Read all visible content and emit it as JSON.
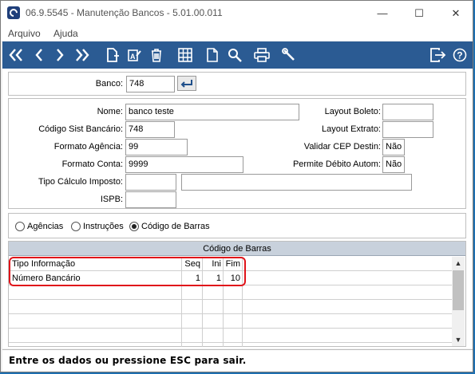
{
  "window": {
    "title": "06.9.5545 - Manutenção Bancos - 5.01.00.011"
  },
  "menu": {
    "items": [
      "Arquivo",
      "Ajuda"
    ]
  },
  "toolbar": {
    "icons": [
      "first-icon",
      "prev-icon",
      "next-icon",
      "last-icon",
      "new-icon",
      "edit-icon",
      "delete-icon",
      "grid-icon",
      "document-icon",
      "search-icon",
      "print-icon",
      "tools-icon",
      "exit-icon",
      "help-icon"
    ]
  },
  "banco": {
    "label": "Banco:",
    "value": "748"
  },
  "form": {
    "nome": {
      "label": "Nome:",
      "value": "banco teste"
    },
    "codigo": {
      "label": "Código Sist Bancário:",
      "value": "748"
    },
    "agencia": {
      "label": "Formato Agência:",
      "value": "99"
    },
    "conta": {
      "label": "Formato Conta:",
      "value": "9999"
    },
    "tipo_calculo": {
      "label": "Tipo Cálculo Imposto:",
      "value": "",
      "value2": ""
    },
    "ispb": {
      "label": "ISPB:",
      "value": ""
    },
    "layout_boleto": {
      "label": "Layout Boleto:",
      "value": ""
    },
    "layout_extrato": {
      "label": "Layout Extrato:",
      "value": ""
    },
    "validar_cep": {
      "label": "Validar CEP Destin:",
      "value": "Não"
    },
    "permite_debito": {
      "label": "Permite Débito Autom:",
      "value": "Não"
    }
  },
  "radios": {
    "agencias": "Agências",
    "instrucoes": "Instruções",
    "codigo_barras": "Código de Barras",
    "selected": "codigo_barras"
  },
  "grid": {
    "title": "Código de Barras",
    "columns": [
      "Tipo Informação",
      "Seq",
      "Ini",
      "Fim"
    ],
    "rows": [
      {
        "tipo": "Número Bancário",
        "seq": "1",
        "ini": "1",
        "fim": "10"
      }
    ]
  },
  "status": {
    "text": "Entre os dados ou pressione ESC para sair."
  },
  "colors": {
    "toolbar": "#2b5b93",
    "highlight": "#e0141a",
    "grid_header": "#c8d1dc"
  }
}
